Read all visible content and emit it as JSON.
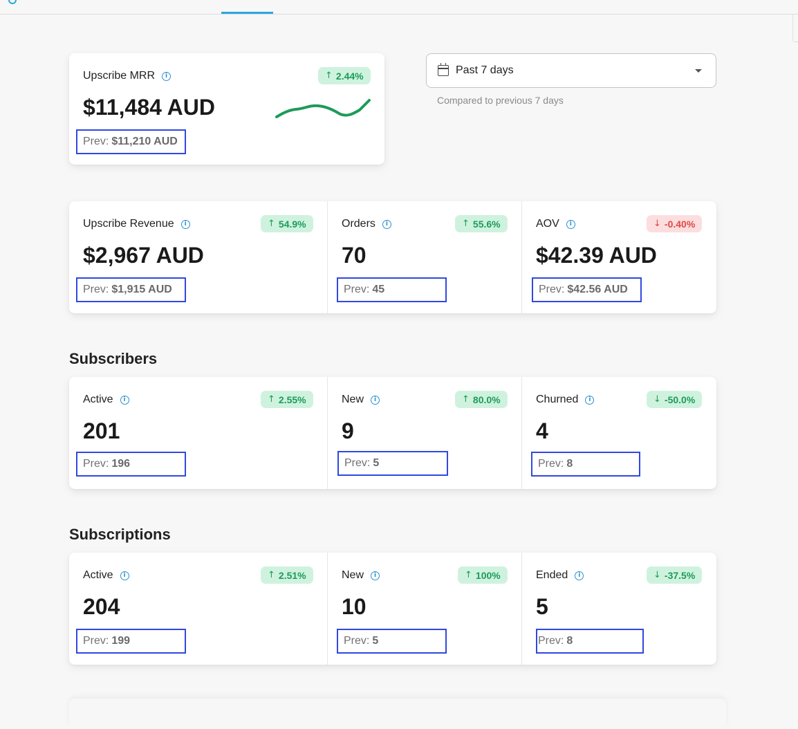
{
  "mrr": {
    "label": "Upscribe MRR",
    "badge": "2.44%",
    "value": "$11,484 AUD",
    "prev_label": "Prev:",
    "prev_value": "$11,210 AUD",
    "trend_color": "#1d9b59"
  },
  "date_filter": {
    "selected": "Past 7 days",
    "note": "Compared to previous 7 days"
  },
  "revenue_row": [
    {
      "label": "Upscribe Revenue",
      "badge": "54.9%",
      "direction": "up",
      "value": "$2,967 AUD",
      "prev_label": "Prev:",
      "prev_value": "$1,915 AUD"
    },
    {
      "label": "Orders",
      "badge": "55.6%",
      "direction": "up",
      "value": "70",
      "prev_label": "Prev:",
      "prev_value": "45"
    },
    {
      "label": "AOV",
      "badge": "-0.40%",
      "direction": "down",
      "value": "$42.39 AUD",
      "prev_label": "Prev:",
      "prev_value": "$42.56 AUD"
    }
  ],
  "subscribers": {
    "title": "Subscribers",
    "cells": [
      {
        "label": "Active",
        "badge": "2.55%",
        "direction": "up",
        "value": "201",
        "prev_label": "Prev:",
        "prev_value": "196"
      },
      {
        "label": "New",
        "badge": "80.0%",
        "direction": "up",
        "value": "9",
        "prev_label": "Prev:",
        "prev_value": "5"
      },
      {
        "label": "Churned",
        "badge": "-50.0%",
        "direction": "up-good",
        "value": "4",
        "prev_label": "Prev:",
        "prev_value": "8"
      }
    ]
  },
  "subscriptions": {
    "title": "Subscriptions",
    "cells": [
      {
        "label": "Active",
        "badge": "2.51%",
        "direction": "up",
        "value": "204",
        "prev_label": "Prev:",
        "prev_value": "199"
      },
      {
        "label": "New",
        "badge": "100%",
        "direction": "up",
        "value": "10",
        "prev_label": "Prev:",
        "prev_value": "5"
      },
      {
        "label": "Ended",
        "badge": "-37.5%",
        "direction": "up-good",
        "value": "5",
        "prev_label": "Prev:",
        "prev_value": "8"
      }
    ]
  },
  "colors": {
    "accent": "#2aa7e0",
    "positive": "#1d9b59",
    "negative": "#e04747",
    "highlight_box": "#2f48e0"
  }
}
